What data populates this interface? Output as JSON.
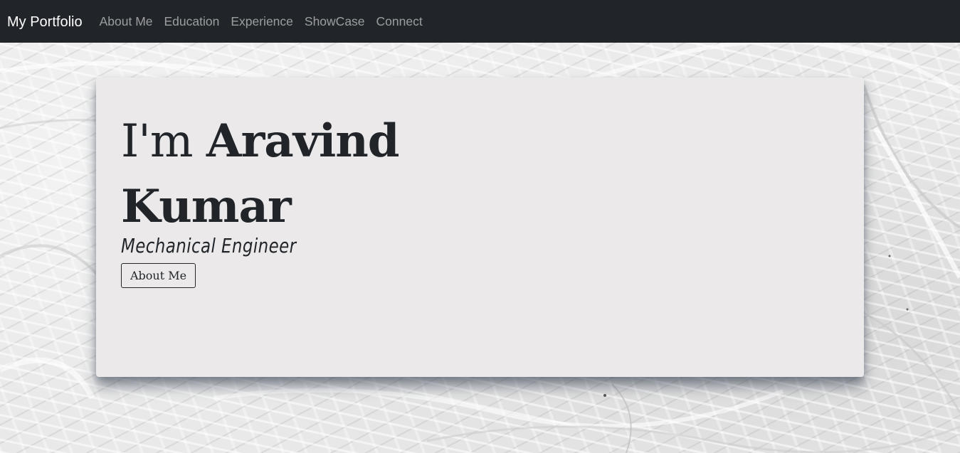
{
  "navbar": {
    "brand": "My Portfolio",
    "links": [
      "About Me",
      "Education",
      "Experience",
      "ShowCase",
      "Connect"
    ]
  },
  "hero": {
    "intro": "I'm",
    "name": "Aravind Kumar",
    "subtitle": "Mechanical Engineer",
    "button_label": "About Me"
  },
  "colors": {
    "navbar_bg": "#212529",
    "card_bg": "#ebe9ea",
    "text": "#212529"
  }
}
